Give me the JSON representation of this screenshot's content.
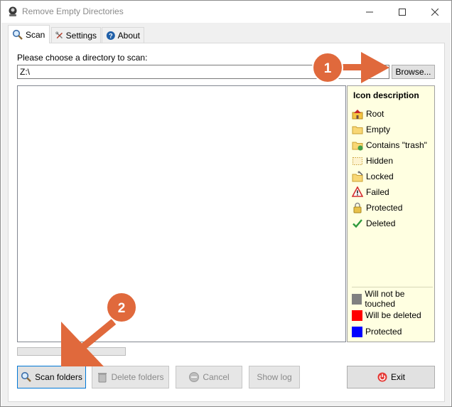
{
  "window": {
    "title": "Remove Empty Directories"
  },
  "tabs": [
    {
      "label": "Scan",
      "icon": "magnifier-icon",
      "active": true
    },
    {
      "label": "Settings",
      "icon": "tools-icon",
      "active": false
    },
    {
      "label": "About",
      "icon": "help-icon",
      "active": false
    }
  ],
  "scan": {
    "choose_label": "Please choose a directory to scan:",
    "directory_value": "Z:\\",
    "browse_label": "Browse..."
  },
  "legend": {
    "title": "Icon description",
    "items": [
      {
        "label": "Root",
        "icon": "root-folder-icon"
      },
      {
        "label": "Empty",
        "icon": "empty-folder-icon"
      },
      {
        "label": "Contains \"trash\"",
        "icon": "trash-folder-icon"
      },
      {
        "label": "Hidden",
        "icon": "hidden-folder-icon"
      },
      {
        "label": "Locked",
        "icon": "locked-folder-icon"
      },
      {
        "label": "Failed",
        "icon": "warning-icon"
      },
      {
        "label": "Protected",
        "icon": "padlock-icon"
      },
      {
        "label": "Deleted",
        "icon": "checkmark-icon"
      }
    ],
    "colors": [
      {
        "label": "Will not be touched",
        "color": "#808080"
      },
      {
        "label": "Will be deleted",
        "color": "#ff0000"
      },
      {
        "label": "Protected",
        "color": "#0000ff"
      }
    ]
  },
  "progress": {
    "value": 0
  },
  "buttons": {
    "scan": "Scan folders",
    "delete": "Delete folders",
    "cancel": "Cancel",
    "log": "Show log",
    "exit": "Exit"
  },
  "annotations": {
    "badge1": "1",
    "badge2": "2",
    "color": "#e0693c"
  }
}
